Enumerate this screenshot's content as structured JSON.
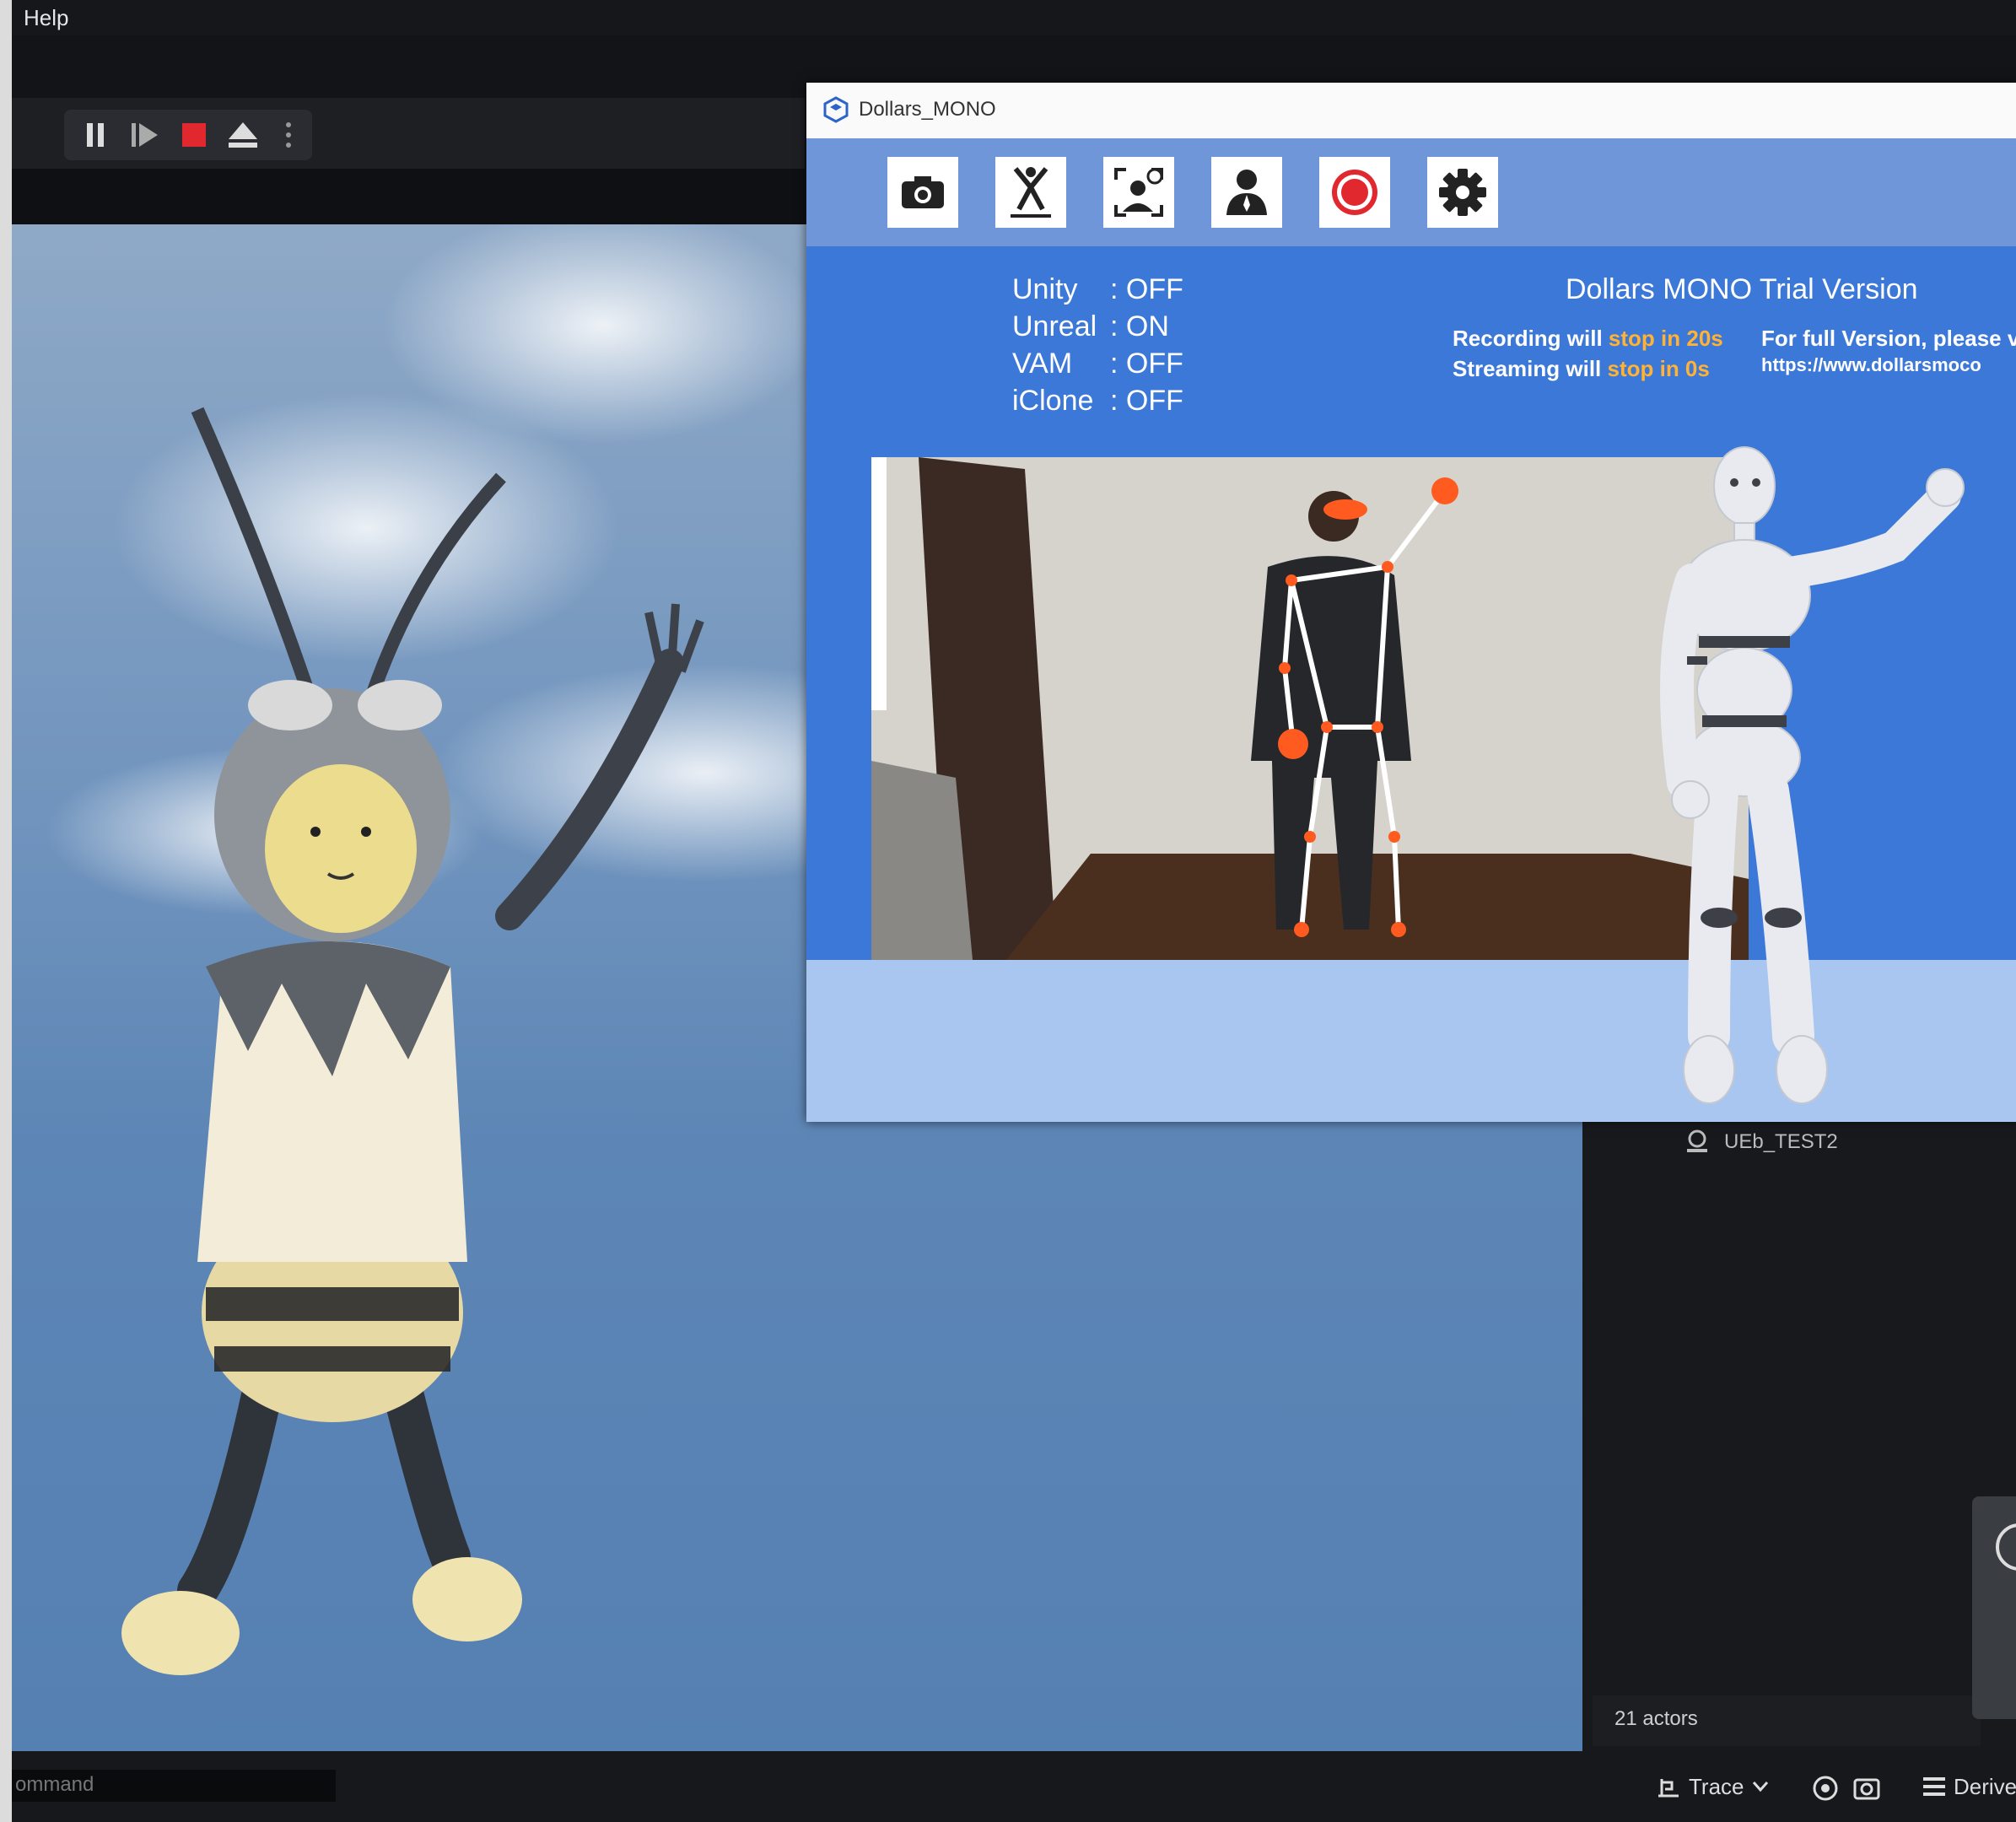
{
  "menubar": {
    "help": "Help"
  },
  "mono_window": {
    "title": "Dollars_MONO",
    "tools": [
      "camera-icon",
      "pose-icon",
      "face-capture-icon",
      "person-icon",
      "record-icon",
      "settings-icon"
    ],
    "status": [
      {
        "name": "Unity",
        "value": ": OFF"
      },
      {
        "name": "Unreal",
        "value": ": ON"
      },
      {
        "name": "VAM",
        "value": ": OFF"
      },
      {
        "name": "iClone",
        "value": ": OFF"
      }
    ],
    "version_title": "Dollars MONO Trial Version",
    "recording_prefix": "Recording will",
    "recording_highlight": "stop in 20s",
    "streaming_prefix": "Streaming will",
    "streaming_highlight": "stop in 0s",
    "full_version_line1": "For full Version, please v",
    "full_version_line2": "https://www.dollarsmoco"
  },
  "outliner": {
    "item": "UEb_TEST2",
    "actors": "21 actors"
  },
  "statusbar": {
    "command_placeholder": "ommand",
    "trace": "Trace",
    "derived": "Derived"
  },
  "colors": {
    "accent_highlight": "#ffb233",
    "panel_blue": "#3c78d8",
    "record_red": "#e0282e"
  }
}
